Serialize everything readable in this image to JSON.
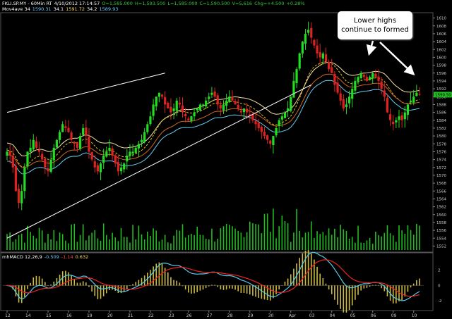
{
  "header": {
    "line1": [
      {
        "text": "FKLI.SP.MY - 60Min RT",
        "color": "#ffffff"
      },
      {
        "text": "4/10/2012 17:14:57",
        "color": "#ffffff"
      },
      {
        "text": "O=1,585.000",
        "color": "#33cc33"
      },
      {
        "text": "H=1,593.500",
        "color": "#33cc33"
      },
      {
        "text": "L=1,585.000",
        "color": "#33cc33"
      },
      {
        "text": "C=1,590.500",
        "color": "#33cc33"
      },
      {
        "text": "V=5,616",
        "color": "#33cc33"
      },
      {
        "text": "Chg=+4.500",
        "color": "#33cc33"
      },
      {
        "text": "+0.28%",
        "color": "#33cc33"
      }
    ],
    "line2": [
      {
        "text": "Mov4ave 34",
        "color": "#ffffff"
      },
      {
        "text": "1590.31",
        "color": "#66ccff"
      },
      {
        "text": "34.1",
        "color": "#ffffff"
      },
      {
        "text": "1591.72",
        "color": "#ffdd55"
      },
      {
        "text": "34.2",
        "color": "#ffffff"
      },
      {
        "text": "1589.93",
        "color": "#66ccff"
      }
    ]
  },
  "callout": {
    "line1": "Lower highs",
    "line2": "continue to formed"
  },
  "macd_header": [
    {
      "text": "mhMACD 12,26,9",
      "color": "#ffffff"
    },
    {
      "text": "-0.509",
      "color": "#66ccff"
    },
    {
      "text": "-1.14",
      "color": "#ff4444"
    },
    {
      "text": "0.632",
      "color": "#ffdd55"
    }
  ],
  "last_price_label": "1590.50",
  "chart_data": {
    "type": "candlestick",
    "x_ticks": [
      "12",
      "14",
      "15",
      "16",
      "19",
      "20",
      "21",
      "22",
      "23",
      "26",
      "27",
      "28",
      "29",
      "30",
      "Apr",
      "03",
      "04",
      "05",
      "06",
      "09",
      "10"
    ],
    "price_ticks": [
      1552,
      1554,
      1556,
      1558,
      1560,
      1562,
      1564,
      1566,
      1568,
      1570,
      1572,
      1574,
      1576,
      1578,
      1580,
      1582,
      1584,
      1586,
      1588,
      1590,
      1592,
      1594,
      1596,
      1598,
      1600,
      1602,
      1604,
      1606,
      1608,
      1610
    ],
    "ylim": [
      1551,
      1611
    ],
    "macd_ticks": [
      2,
      0,
      -2
    ],
    "macd_ylim": [
      -3,
      4
    ],
    "grid": false,
    "closes": [
      1576,
      1575,
      1572,
      1566,
      1563,
      1566,
      1572,
      1576,
      1577,
      1579,
      1577,
      1576,
      1574,
      1572,
      1571,
      1574,
      1577,
      1579,
      1581,
      1583,
      1582,
      1581,
      1579,
      1578,
      1577,
      1580,
      1582,
      1580,
      1576,
      1574,
      1572,
      1571,
      1573,
      1575,
      1576,
      1577,
      1575,
      1573,
      1571,
      1572,
      1573,
      1575,
      1576,
      1576,
      1577,
      1578,
      1579,
      1581,
      1583,
      1585,
      1588,
      1590,
      1591,
      1590,
      1588,
      1587,
      1586,
      1587,
      1589,
      1588,
      1586,
      1585,
      1584,
      1585,
      1586,
      1587,
      1588,
      1588,
      1589,
      1590,
      1591,
      1590,
      1588,
      1587,
      1588,
      1589,
      1590,
      1589,
      1588,
      1587,
      1586,
      1587,
      1586,
      1585,
      1584,
      1583,
      1582,
      1581,
      1580,
      1579,
      1578,
      1580,
      1582,
      1584,
      1585,
      1586,
      1587,
      1590,
      1594,
      1597,
      1601,
      1604,
      1606,
      1607,
      1605,
      1603,
      1601,
      1600,
      1601,
      1599,
      1597,
      1596,
      1593,
      1591,
      1589,
      1587,
      1588,
      1590,
      1592,
      1594,
      1595,
      1596,
      1595,
      1594,
      1595,
      1596,
      1595,
      1594,
      1592,
      1590,
      1586,
      1584,
      1583,
      1584,
      1585,
      1584,
      1586,
      1588,
      1589,
      1590,
      1591,
      1590.5
    ],
    "ema_fast": "computed",
    "trendlines": [
      {
        "from": [
          0,
          1586
        ],
        "to": [
          54,
          1596
        ]
      },
      {
        "from": [
          0,
          1554
        ],
        "to": [
          104,
          1593
        ]
      }
    ],
    "volumes_label": "volume"
  }
}
